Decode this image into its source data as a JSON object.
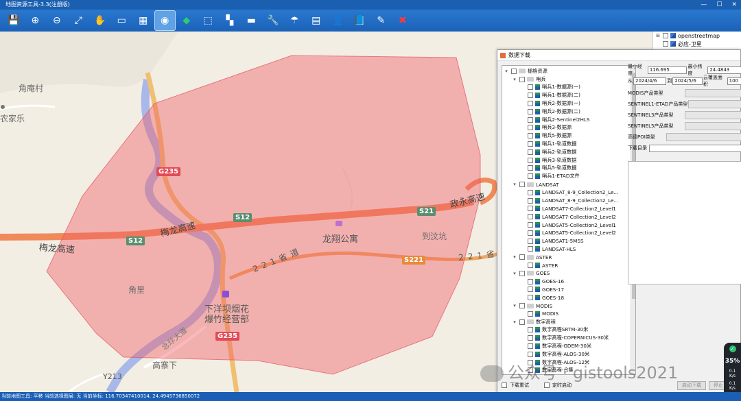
{
  "window": {
    "title": "地图资源工具-3.3(注册版)",
    "minimize": "—",
    "maximize": "☐",
    "close": "✕"
  },
  "toolbar": {
    "items": [
      {
        "name": "save-icon",
        "glyph": "💾"
      },
      {
        "name": "zoom-in-icon",
        "glyph": "⊕"
      },
      {
        "name": "zoom-out-icon",
        "glyph": "⊖"
      },
      {
        "name": "full-extent-icon",
        "glyph": "⤢"
      },
      {
        "name": "pan-hand-icon",
        "glyph": "✋"
      },
      {
        "name": "measure-ruler-icon",
        "glyph": "▭"
      },
      {
        "name": "grid-icon",
        "glyph": "▦"
      },
      {
        "name": "select-pin-icon",
        "glyph": "◉",
        "active": true
      },
      {
        "name": "polygon-draw-icon",
        "glyph": "◆",
        "color": "green"
      },
      {
        "name": "move-icon",
        "glyph": "⬚"
      },
      {
        "name": "tile-icon",
        "glyph": "▚"
      },
      {
        "name": "eraser-icon",
        "glyph": "▬"
      },
      {
        "name": "tools-icon",
        "glyph": "🔧"
      },
      {
        "name": "umbrella-icon",
        "glyph": "☂"
      },
      {
        "name": "layer-stack-icon",
        "glyph": "▤"
      },
      {
        "name": "user-icon",
        "glyph": "👤"
      },
      {
        "name": "book-icon",
        "glyph": "📘"
      },
      {
        "name": "pencil-icon",
        "glyph": "✎"
      },
      {
        "name": "exit-icon",
        "glyph": "✖",
        "color": "red"
      }
    ]
  },
  "map": {
    "labels": {
      "village1": "角庵村",
      "village2": "农家乐",
      "hotel": "龙翔公寓",
      "place1": "到汶坑",
      "place2": "角里",
      "shop_line1": "下洋坝烟花",
      "shop_line2": "爆竹经营部",
      "place3": "高寨下",
      "road_y": "Y213",
      "expressway_west": "梅龙高速",
      "expressway_mid": "梅龙高速",
      "expressway_east": "政永高速",
      "provincial": "221省道",
      "provincial_east": "221省",
      "road_small": "念珍大道"
    },
    "shields": {
      "g235_top": "G235",
      "g235_bottom": "G235",
      "s12_left": "S12",
      "s12_right": "S12",
      "s21": "S21",
      "s221": "S221"
    }
  },
  "layers_panel": {
    "items": [
      {
        "label": "openstreetmap",
        "expand": "⊞",
        "checked": false
      },
      {
        "label": "必应-卫星",
        "expand": "",
        "checked": false
      }
    ]
  },
  "dialog": {
    "title": "数据下载",
    "tree": [
      {
        "level": 0,
        "expand": "▾",
        "label": "栅格资源",
        "folder": true
      },
      {
        "level": 1,
        "expand": "▾",
        "label": "哨兵",
        "folder": true
      },
      {
        "level": 2,
        "label": "哨兵1-数据源(一)"
      },
      {
        "level": 2,
        "label": "哨兵1-数据源(二)"
      },
      {
        "level": 2,
        "label": "哨兵2-数据源(一)"
      },
      {
        "level": 2,
        "label": "哨兵2-数据源(二)"
      },
      {
        "level": 2,
        "label": "哨兵2-Sentinel2HLS"
      },
      {
        "level": 2,
        "label": "哨兵3-数据源"
      },
      {
        "level": 2,
        "label": "哨兵5-数据源"
      },
      {
        "level": 2,
        "label": "哨兵1-轨道数据"
      },
      {
        "level": 2,
        "label": "哨兵2-轨道数据"
      },
      {
        "level": 2,
        "label": "哨兵3-轨道数据"
      },
      {
        "level": 2,
        "label": "哨兵5-轨道数据"
      },
      {
        "level": 2,
        "label": "哨兵1-ETAD文件"
      },
      {
        "level": 1,
        "expand": "▾",
        "label": "LANDSAT",
        "folder": true
      },
      {
        "level": 2,
        "label": "LANDSAT_8-9_Collection2_Le..."
      },
      {
        "level": 2,
        "label": "LANDSAT_8-9_Collection2_Le..."
      },
      {
        "level": 2,
        "label": "LANDSAT7-Collection2_Level1"
      },
      {
        "level": 2,
        "label": "LANDSAT7-Collection2_Level2"
      },
      {
        "level": 2,
        "label": "LANDSAT5-Collection2_Level1"
      },
      {
        "level": 2,
        "label": "LANDSAT5-Collection2_Level2"
      },
      {
        "level": 2,
        "label": "LANDSAT1-5MSS"
      },
      {
        "level": 2,
        "label": "LANDSAT-HLS"
      },
      {
        "level": 1,
        "expand": "▾",
        "label": "ASTER",
        "folder": true
      },
      {
        "level": 2,
        "label": "ASTER"
      },
      {
        "level": 1,
        "expand": "▾",
        "label": "GOES",
        "folder": true
      },
      {
        "level": 2,
        "label": "GOES-16"
      },
      {
        "level": 2,
        "label": "GOES-17"
      },
      {
        "level": 2,
        "label": "GOES-18"
      },
      {
        "level": 1,
        "expand": "▾",
        "label": "MODIS",
        "folder": true
      },
      {
        "level": 2,
        "label": "MODIS"
      },
      {
        "level": 1,
        "expand": "▾",
        "label": "数字高程",
        "folder": true
      },
      {
        "level": 2,
        "label": "数字高程SRTM-30米"
      },
      {
        "level": 2,
        "label": "数字高程-COPERNICUS-30米"
      },
      {
        "level": 2,
        "label": "数字高程-GDEM-30米"
      },
      {
        "level": 2,
        "label": "数字高程-ALOS-30米"
      },
      {
        "level": 2,
        "label": "数字高程-ALOS-12米"
      },
      {
        "level": 2,
        "label": "数字高程-合集"
      }
    ],
    "form": {
      "min_lon_label": "最小经度",
      "min_lon_value": "116.695",
      "min_lat_label": "最小纬度",
      "min_lat_value": "24.4843",
      "from_label": "从",
      "from_value": "2024/4/6",
      "to_label": "到",
      "to_value": "2024/5/6",
      "cloud_label": "云覆盖面积",
      "cloud_value": "100",
      "modis_label": "MODIS产品类型",
      "s1_label": "SENTINEL1-ETAD产品类型",
      "s3_label": "SENTINEL3产品类型",
      "s5_label": "SENTINEL5产品类型",
      "gaode_label": "高德POI类型",
      "dir_label": "下载目录"
    },
    "bottom": {
      "retry_label": "下载重试",
      "timer_label": "定时启动",
      "start_button": "启动下载",
      "stop_button": "停止下载"
    }
  },
  "status": {
    "text": "当前地图工具: 平移 当前选择图层: 无 当前坐标: 116.70347410014, 24.4945736850072"
  },
  "watermark": {
    "text": "公众号 · gistools2021"
  },
  "net_widget": {
    "big": "35",
    "unit": "%",
    "up": "0.1",
    "up_unit": "K/s",
    "down": "0.1",
    "down_unit": "K/s"
  }
}
